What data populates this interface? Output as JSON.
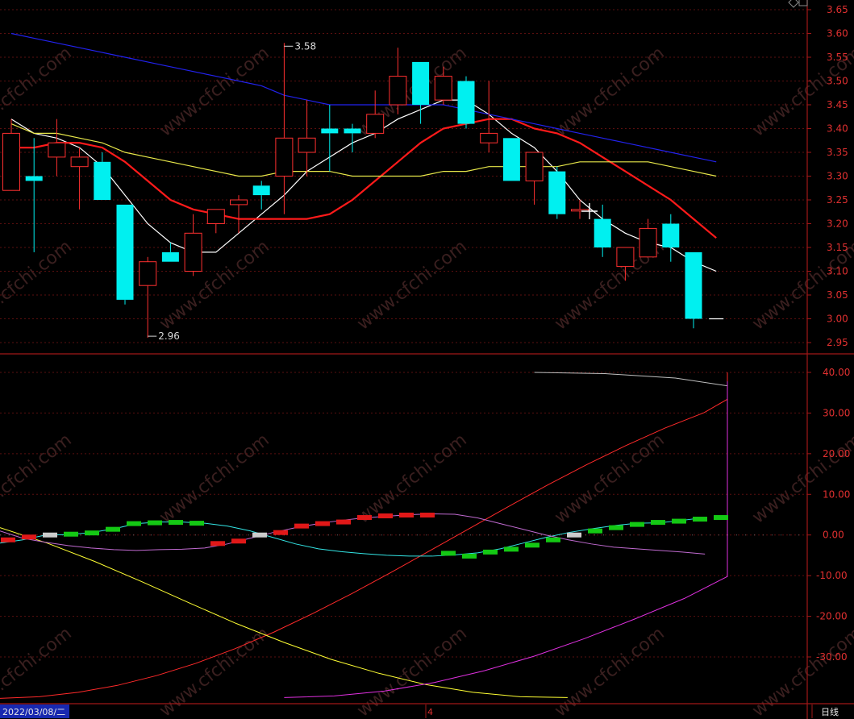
{
  "chart_data": [
    {
      "type": "candlestick",
      "name": "price",
      "yticks": [
        "3.65",
        "3.60",
        "3.55",
        "3.50",
        "3.45",
        "3.40",
        "3.35",
        "3.30",
        "3.25",
        "3.20",
        "3.15",
        "3.10",
        "3.05",
        "3.00",
        "2.95"
      ],
      "ylim": [
        2.93,
        3.67
      ],
      "grid": true,
      "candles": [
        {
          "o": 3.27,
          "h": 3.42,
          "l": 3.27,
          "c": 3.39
        },
        {
          "o": 3.3,
          "h": 3.38,
          "l": 3.14,
          "c": 3.29
        },
        {
          "o": 3.34,
          "h": 3.42,
          "l": 3.3,
          "c": 3.37
        },
        {
          "o": 3.32,
          "h": 3.36,
          "l": 3.23,
          "c": 3.34
        },
        {
          "o": 3.33,
          "h": 3.35,
          "l": 3.25,
          "c": 3.25
        },
        {
          "o": 3.24,
          "h": 3.24,
          "l": 3.03,
          "c": 3.04
        },
        {
          "o": 3.07,
          "h": 3.13,
          "l": 2.96,
          "c": 3.12
        },
        {
          "o": 3.14,
          "h": 3.16,
          "l": 3.12,
          "c": 3.12
        },
        {
          "o": 3.1,
          "h": 3.22,
          "l": 3.09,
          "c": 3.18
        },
        {
          "o": 3.2,
          "h": 3.23,
          "l": 3.18,
          "c": 3.23
        },
        {
          "o": 3.24,
          "h": 3.26,
          "l": 3.18,
          "c": 3.25
        },
        {
          "o": 3.28,
          "h": 3.29,
          "l": 3.23,
          "c": 3.26
        },
        {
          "o": 3.3,
          "h": 3.58,
          "l": 3.22,
          "c": 3.38
        },
        {
          "o": 3.35,
          "h": 3.46,
          "l": 3.3,
          "c": 3.38
        },
        {
          "o": 3.4,
          "h": 3.45,
          "l": 3.31,
          "c": 3.39
        },
        {
          "o": 3.4,
          "h": 3.41,
          "l": 3.35,
          "c": 3.39
        },
        {
          "o": 3.39,
          "h": 3.48,
          "l": 3.38,
          "c": 3.43
        },
        {
          "o": 3.45,
          "h": 3.57,
          "l": 3.43,
          "c": 3.51
        },
        {
          "o": 3.54,
          "h": 3.54,
          "l": 3.41,
          "c": 3.45
        },
        {
          "o": 3.46,
          "h": 3.53,
          "l": 3.45,
          "c": 3.51
        },
        {
          "o": 3.5,
          "h": 3.51,
          "l": 3.4,
          "c": 3.41
        },
        {
          "o": 3.37,
          "h": 3.5,
          "l": 3.35,
          "c": 3.39
        },
        {
          "o": 3.38,
          "h": 3.38,
          "l": 3.29,
          "c": 3.29
        },
        {
          "o": 3.29,
          "h": 3.35,
          "l": 3.24,
          "c": 3.35
        },
        {
          "o": 3.31,
          "h": 3.32,
          "l": 3.21,
          "c": 3.22
        },
        {
          "o": 3.23,
          "h": 3.25,
          "l": 3.21,
          "c": 3.23
        },
        {
          "o": 3.21,
          "h": 3.24,
          "l": 3.13,
          "c": 3.15
        },
        {
          "o": 3.11,
          "h": 3.15,
          "l": 3.08,
          "c": 3.15
        },
        {
          "o": 3.13,
          "h": 3.21,
          "l": 3.13,
          "c": 3.19
        },
        {
          "o": 3.2,
          "h": 3.22,
          "l": 3.12,
          "c": 3.15
        },
        {
          "o": 3.14,
          "h": 3.14,
          "l": 2.98,
          "c": 3.0
        },
        {
          "o": 3.0,
          "h": 3.0,
          "l": 3.0,
          "c": 3.0
        }
      ],
      "annotations": [
        {
          "text": "3.58",
          "index": 12,
          "value": 3.58
        },
        {
          "text": "2.96",
          "index": 6,
          "value": 2.96
        }
      ],
      "lines": [
        {
          "name": "",
          "color": "#ffffff",
          "values": [
            3.42,
            3.39,
            3.38,
            3.36,
            3.32,
            3.26,
            3.2,
            3.16,
            3.14,
            3.14,
            3.18,
            3.22,
            3.26,
            3.31,
            3.34,
            3.37,
            3.39,
            3.42,
            3.44,
            3.46,
            3.46,
            3.43,
            3.39,
            3.36,
            3.31,
            3.25,
            3.21,
            3.18,
            3.16,
            3.15,
            3.12,
            3.1
          ]
        },
        {
          "name": "",
          "color": "#ff1a1a",
          "values": [
            3.36,
            3.36,
            3.37,
            3.37,
            3.36,
            3.33,
            3.29,
            3.25,
            3.23,
            3.22,
            3.21,
            3.21,
            3.21,
            3.21,
            3.22,
            3.25,
            3.29,
            3.33,
            3.37,
            3.4,
            3.41,
            3.42,
            3.42,
            3.4,
            3.39,
            3.37,
            3.34,
            3.31,
            3.28,
            3.25,
            3.21,
            3.17
          ]
        },
        {
          "name": "",
          "color": "#e8e84a",
          "values": [
            3.41,
            3.39,
            3.39,
            3.38,
            3.37,
            3.35,
            3.34,
            3.33,
            3.32,
            3.31,
            3.3,
            3.3,
            3.31,
            3.31,
            3.31,
            3.3,
            3.3,
            3.3,
            3.3,
            3.31,
            3.31,
            3.32,
            3.32,
            3.32,
            3.32,
            3.33,
            3.33,
            3.33,
            3.33,
            3.32,
            3.31,
            3.3
          ]
        },
        {
          "name": "",
          "color": "#2222ee",
          "values": [
            3.6,
            3.59,
            3.58,
            3.57,
            3.56,
            3.55,
            3.54,
            3.53,
            3.52,
            3.51,
            3.5,
            3.49,
            3.47,
            3.46,
            3.45,
            3.45,
            3.45,
            3.45,
            3.45,
            3.45,
            3.44,
            3.43,
            3.42,
            3.41,
            3.4,
            3.39,
            3.38,
            3.37,
            3.36,
            3.35,
            3.34,
            3.33
          ]
        }
      ]
    },
    {
      "type": "line",
      "name": "indicator",
      "yticks": [
        "40.00",
        "30.00",
        "20.00",
        "10.00",
        "0.00",
        "-10.00",
        "-20.00",
        "-30.00"
      ],
      "ylim": [
        -40.5,
        44.5
      ],
      "grid": true,
      "series": [
        {
          "name": "",
          "color": "#ff2a2a",
          "x_start": 0,
          "values": [
            -40.2,
            -39.8,
            -38.7,
            -37.0,
            -34.6,
            -31.6,
            -28.0,
            -23.9,
            -19.3,
            -14.4,
            -9.2,
            -3.8,
            1.6,
            7.0,
            12.3,
            17.3,
            22.0,
            26.3,
            30.1,
            33.4,
            36.1,
            38.1,
            39.5,
            40.0
          ]
        },
        {
          "name": "",
          "color": "#bfbfbf",
          "x_start": 23,
          "values": [
            40.0,
            39.7,
            38.6,
            36.7,
            34.0,
            30.7,
            26.7,
            22.1,
            17.3,
            12.3
          ]
        },
        {
          "name": "",
          "color": "#ffff33",
          "x_start": 0,
          "values": [
            1.8,
            -2.0,
            -6.5,
            -11.5,
            -16.7,
            -21.8,
            -26.4,
            -30.6,
            -34.0,
            -36.8,
            -38.7,
            -39.8,
            -40.0
          ]
        },
        {
          "name": "",
          "color": "#e030e0",
          "x_start": 12,
          "values": [
            -40.0,
            -39.6,
            -38.4,
            -36.3,
            -33.4,
            -29.8,
            -25.5,
            -20.7,
            -15.6,
            -10.2,
            -4.6,
            1.0,
            6.6,
            12.1,
            17.4,
            22.3,
            26.7,
            30.6,
            33.9,
            36.5,
            37.8
          ]
        },
        {
          "name": "",
          "color": "#33e6e6",
          "x_start": 0,
          "values": [
            -2.0,
            -1.2,
            0.0,
            0.1,
            0.6,
            1.5,
            2.8,
            3.2,
            3.2,
            2.9,
            2.2,
            1.0,
            -0.6,
            -2.2,
            -3.4,
            -4.1,
            -4.6,
            -5.0,
            -5.2,
            -5.2,
            -4.9,
            -4.4,
            -3.4,
            -2.0,
            -0.6,
            0.6,
            1.5,
            2.3,
            2.9,
            3.0,
            3.6,
            4.3
          ]
        },
        {
          "name": "",
          "color": "#c06ad0",
          "x_start": 0,
          "values": [
            1.0,
            -0.8,
            -1.8,
            -2.6,
            -3.2,
            -3.6,
            -3.8,
            -3.6,
            -3.5,
            -3.2,
            -2.2,
            -0.8,
            0.6,
            1.8,
            2.8,
            3.6,
            4.2,
            4.6,
            5.0,
            5.2,
            5.1,
            4.2,
            2.8,
            1.4,
            0.0,
            -1.2,
            -2.2,
            -3.0,
            -3.4,
            -3.8,
            -4.2,
            -4.7
          ]
        }
      ],
      "bars": [
        -1.2,
        -0.5,
        0.0,
        0.2,
        0.5,
        1.4,
        2.8,
        3.0,
        3.1,
        2.9,
        -2.1,
        -1.5,
        0.0,
        0.6,
        2.2,
        2.8,
        3.2,
        4.3,
        4.7,
        4.9,
        4.9,
        -4.5,
        -5.2,
        -4.2,
        -3.5,
        -2.5,
        -1.2,
        0.0,
        1.0,
        1.8,
        2.6,
        3.1,
        3.4,
        3.9,
        4.3
      ]
    }
  ],
  "status_bar": {
    "date_label": "2022/03/08/二",
    "mid_marker": "4",
    "period_label": "日线"
  },
  "watermark": "www.cfchi.com"
}
